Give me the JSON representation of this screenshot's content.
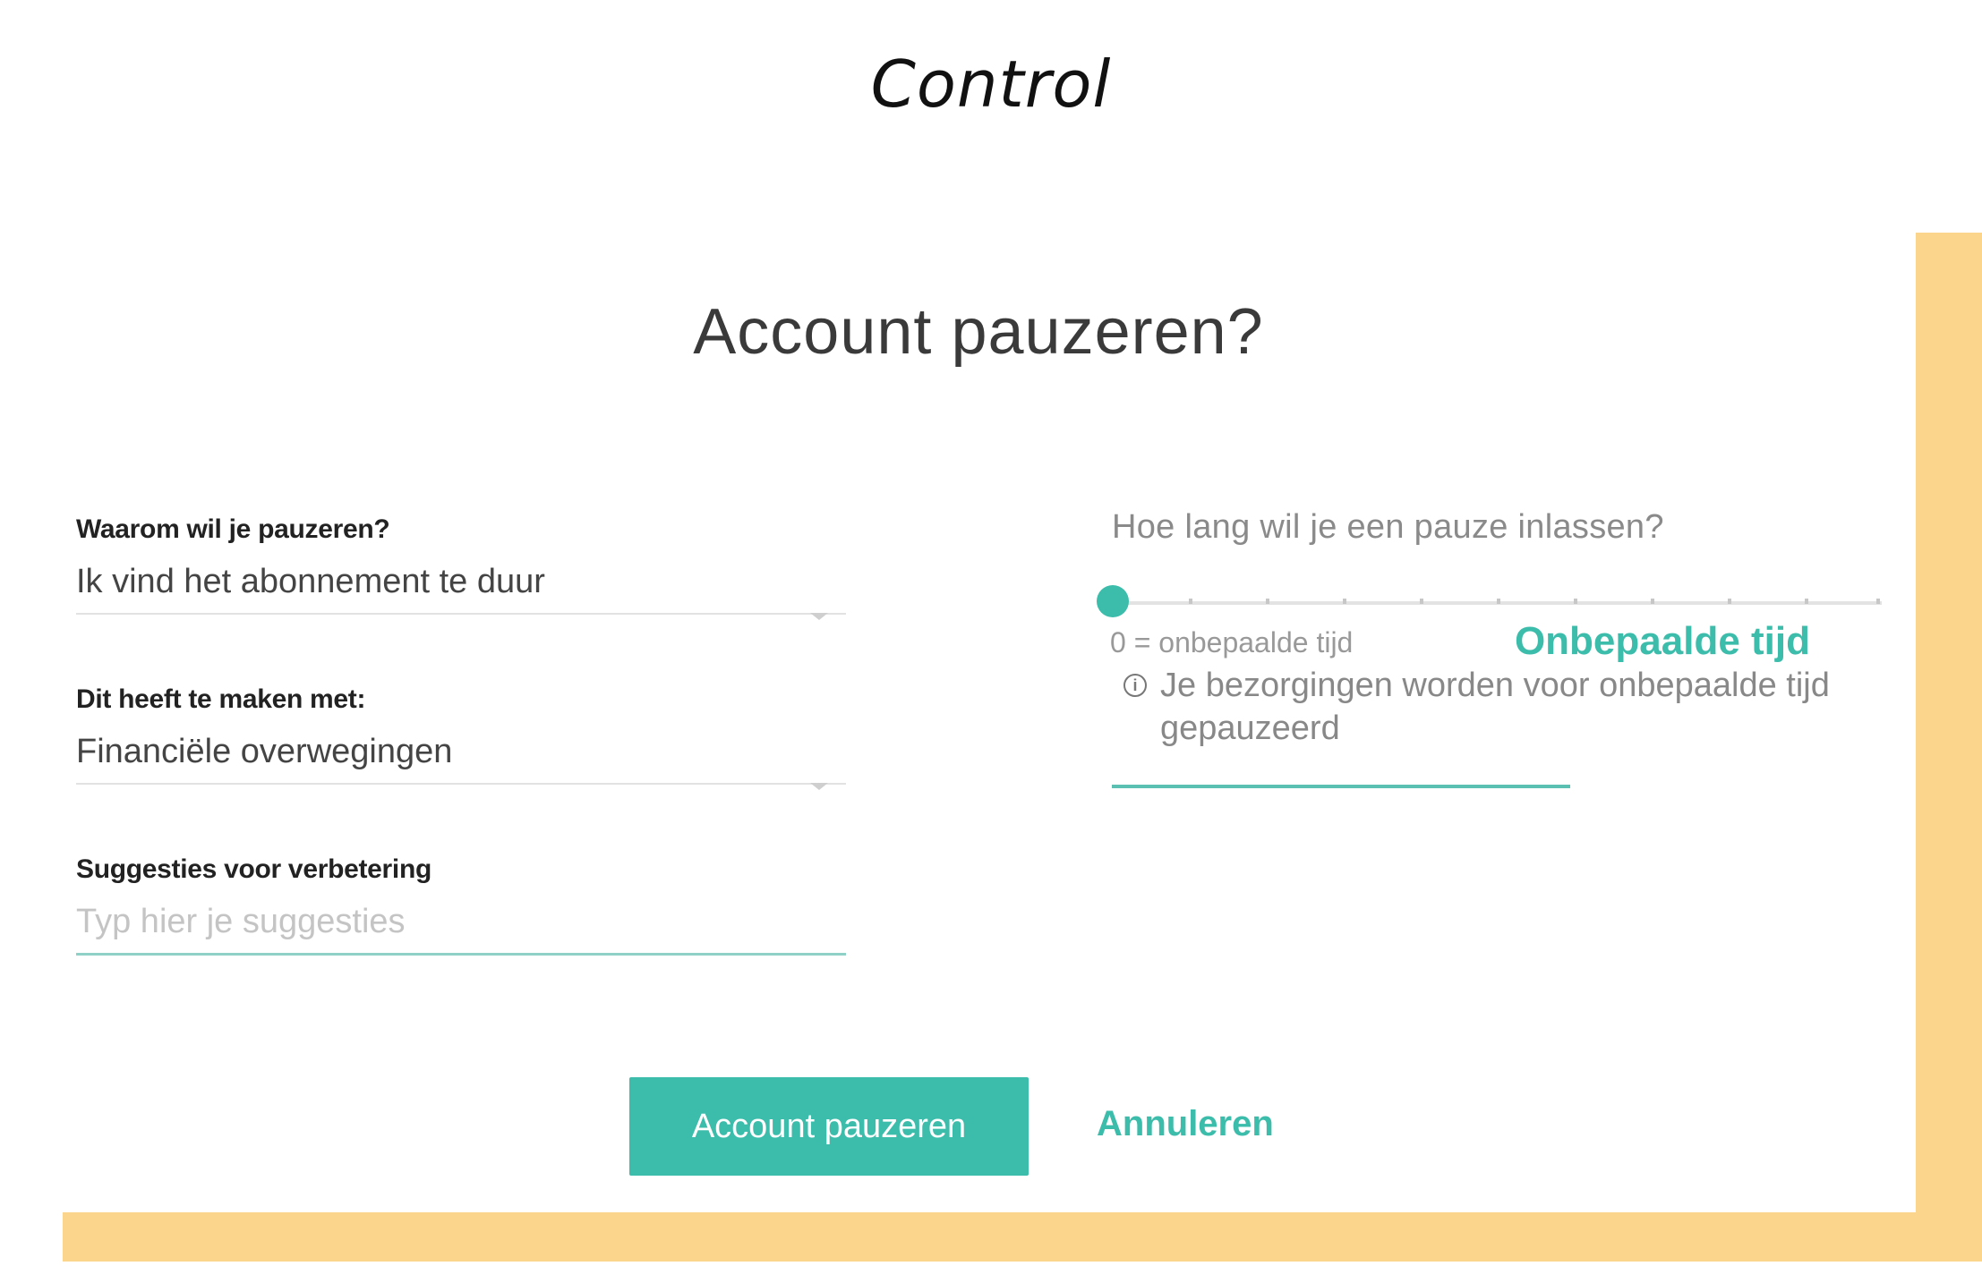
{
  "caption": "Control",
  "dialog": {
    "title": "Account pauzeren?",
    "reason": {
      "label": "Waarom wil je pauzeren?",
      "value": "Ik vind het abonnement te duur"
    },
    "related": {
      "label": "Dit heeft te maken met:",
      "value": "Financiële overwegingen"
    },
    "suggestions": {
      "label": "Suggesties voor verbetering",
      "placeholder": "Typ hier je suggesties"
    },
    "duration": {
      "label": "Hoe lang wil je een pauze inlassen?",
      "min_label": "0 = onbepaalde tijd",
      "value_label": "Onbepaalde tijd",
      "slider_value": 0,
      "info_icon": "info-icon",
      "info_text": "Je bezorgingen worden voor onbepaalde tijd gepauzeerd"
    },
    "actions": {
      "primary": "Account pauzeren",
      "cancel": "Annuleren"
    }
  },
  "colors": {
    "accent": "#3cbcaa",
    "frame": "#fbd58b"
  }
}
